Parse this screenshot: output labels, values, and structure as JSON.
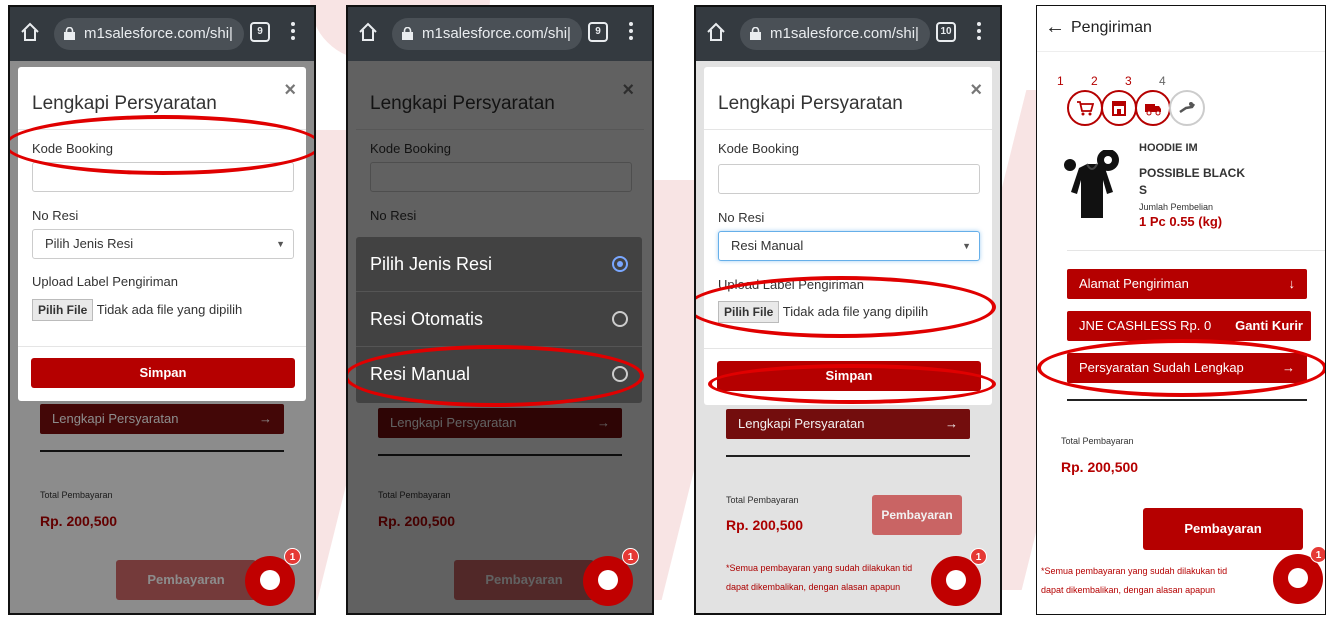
{
  "colors": {
    "accent": "#b50000",
    "dark_accent": "#7a0e0e",
    "chrome": "#343a40",
    "annotation": "#e00000"
  },
  "browser": {
    "url": "m1salesforce.com/shi|"
  },
  "modal": {
    "title": "Lengkapi Persyaratan",
    "close": "×",
    "kode_booking_label": "Kode Booking",
    "no_resi_label": "No Resi",
    "upload_label": "Upload Label Pengiriman",
    "upload_label_cut": "Upload Label Pengiriman",
    "file_button": "Pilih File",
    "file_status": "Tidak ada file yang dipilih",
    "save_button": "Simpan"
  },
  "page": {
    "lengkapi_button": "Lengkapi Persyaratan",
    "arrow": "→",
    "total_label": "Total Pembayaran",
    "total_value": "Rp. 200,500",
    "pay_button": "Pembayaran",
    "note_line1": "*Semua pembayaran yang sudah dilakukan tid",
    "note_line2": "dapat dikembalikan, dengan alasan apapun"
  },
  "screens": [
    {
      "tab_count": "9",
      "resi_value": "Pilih Jenis Resi"
    },
    {
      "tab_count": "9"
    },
    {
      "tab_count": "10",
      "resi_value": "Resi Manual"
    }
  ],
  "picker": {
    "options": [
      {
        "label": "Pilih Jenis Resi",
        "selected": true
      },
      {
        "label": "Resi Otomatis",
        "selected": false
      },
      {
        "label": "Resi Manual",
        "selected": false
      }
    ]
  },
  "chat": {
    "badge": "1"
  },
  "shipping": {
    "back_arrow": "←",
    "title": "Pengiriman",
    "steps": [
      "1",
      "2",
      "3",
      "4"
    ],
    "product_name_cut": "HOODIE IM",
    "product_name_line2": "POSSIBLE BLACK",
    "product_variant": "S",
    "qty_label": "Jumlah Pembelian",
    "qty_value": "1 Pc 0.55 (kg)",
    "address_button": "Alamat Pengiriman",
    "address_arrow": "↓",
    "courier_label": "JNE CASHLESS Rp. 0",
    "courier_change": "Ganti Kurir",
    "requirements_done": "Persyaratan Sudah Lengkap",
    "total_label": "Total Pembayaran",
    "total_value": "Rp. 200,500",
    "pay_button": "Pembayaran",
    "note_line1": "*Semua pembayaran yang sudah dilakukan tid",
    "note_line2": "dapat dikembalikan, dengan alasan apapun"
  }
}
